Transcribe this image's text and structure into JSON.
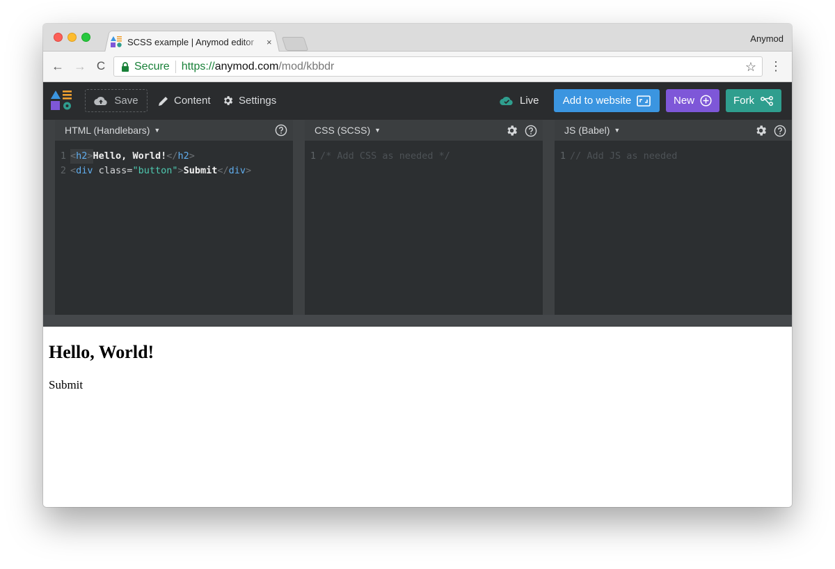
{
  "browser": {
    "tab_title": "SCSS example | Anymod editor",
    "tab_close": "×",
    "profile": "Anymod",
    "secure_label": "Secure",
    "url_scheme": "https://",
    "url_host": "anymod.com",
    "url_path": "/mod/kbbdr",
    "back": "←",
    "forward": "→",
    "reload": "C",
    "star": "☆",
    "menu": "⋮"
  },
  "appbar": {
    "save_label": "Save",
    "content_label": "Content",
    "settings_label": "Settings",
    "live_label": "Live",
    "add_label": "Add to website",
    "new_label": "New",
    "fork_label": "Fork"
  },
  "editors": {
    "html": {
      "title": "HTML (Handlebars)",
      "caret": "▼",
      "lines": [
        {
          "n": "1",
          "open_lt": "<",
          "tag": "h2",
          "open_gt": ">",
          "text": "Hello, World!",
          "close": "</",
          "close_tag": "h2",
          "close_gt": ">"
        },
        {
          "n": "2",
          "open_lt": "<",
          "tag": "div",
          "attr": " class=",
          "str": "\"button\"",
          "open_gt": ">",
          "text": "Submit",
          "close": "</",
          "close_tag": "div",
          "close_gt": ">"
        }
      ]
    },
    "css": {
      "title": "CSS (SCSS)",
      "caret": "▼",
      "line_number": "1",
      "placeholder": "/* Add CSS as needed */"
    },
    "js": {
      "title": "JS (Babel)",
      "caret": "▼",
      "line_number": "1",
      "placeholder": "// Add JS as needed"
    }
  },
  "preview": {
    "heading": "Hello, World!",
    "body": "Submit"
  },
  "colors": {
    "add_button": "#3b95e0",
    "new_button": "#7e57d8",
    "fork_button": "#2f9e8e",
    "secure_green": "#188038",
    "live_icon": "#2f9e8e"
  }
}
